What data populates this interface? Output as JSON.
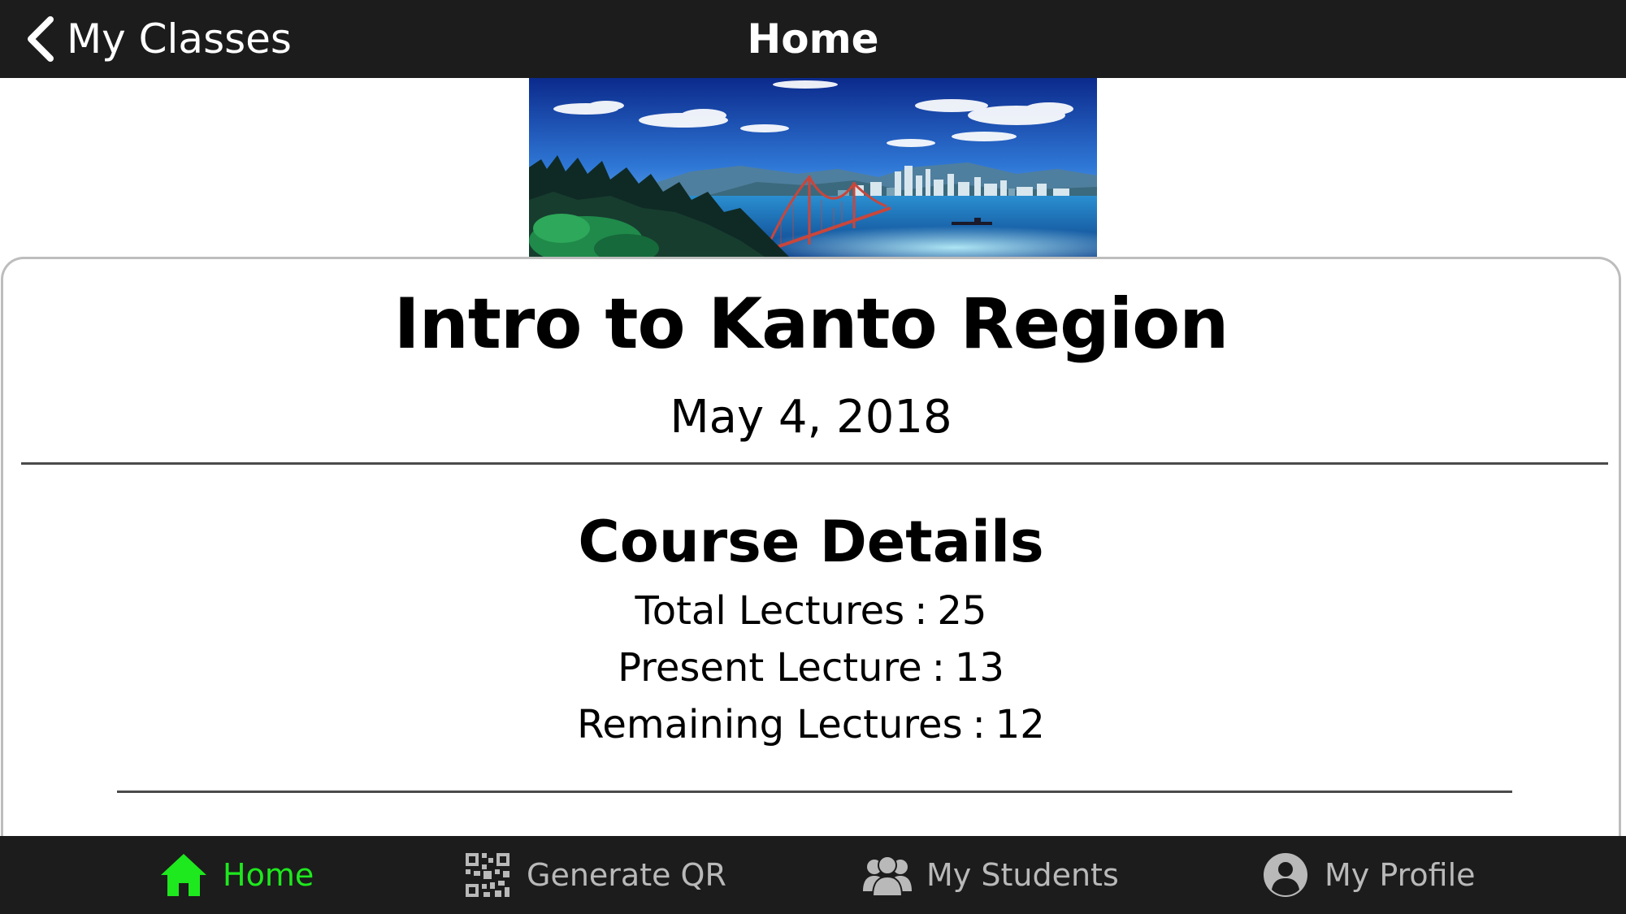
{
  "navbar": {
    "back_label": "My Classes",
    "title": "Home"
  },
  "class": {
    "title": "Intro to Kanto Region",
    "date": "May 4, 2018"
  },
  "course_details": {
    "heading": "Course Details",
    "lines": [
      {
        "label": "Total Lectures",
        "sep": ":",
        "value": "25"
      },
      {
        "label": "Present Lecture",
        "sep": ":",
        "value": "13"
      },
      {
        "label": "Remaining Lectures",
        "sep": ":",
        "value": "12"
      }
    ]
  },
  "tabs": [
    {
      "label": "Home",
      "icon": "home-icon",
      "active": true
    },
    {
      "label": "Generate QR",
      "icon": "qr-code-icon",
      "active": false
    },
    {
      "label": "My Students",
      "icon": "students-icon",
      "active": false
    },
    {
      "label": "My Profile",
      "icon": "profile-icon",
      "active": false
    }
  ],
  "colors": {
    "bar_background": "#1c1c1c",
    "active_tab": "#1ee81e",
    "inactive_tab": "#b9b9b9"
  }
}
